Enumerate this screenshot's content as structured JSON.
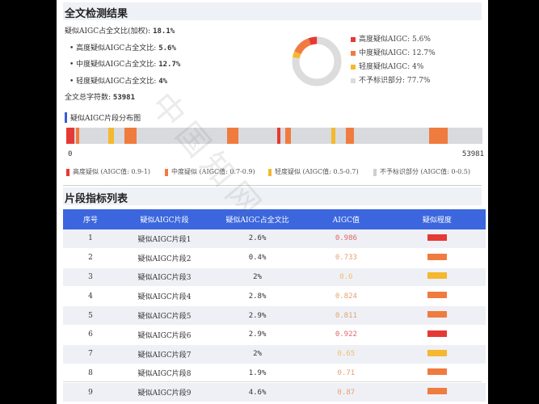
{
  "summary": {
    "title": "全文检测结果",
    "overall_label": "疑似AIGC占全文比(加权):",
    "overall_value": "18.1%",
    "high_label": "• 高度疑似AIGC占全文比:",
    "high_value": "5.6%",
    "mid_label": "• 中度疑似AIGC占全文比:",
    "mid_value": "12.7%",
    "low_label": "• 轻度疑似AIGC占全文比:",
    "low_value": "4%",
    "total_label": "全文总字符数:",
    "total_value": "53981"
  },
  "donut": {
    "legend": [
      {
        "label": "高度疑似AIGC: 5.6%",
        "color": "#e53935",
        "value": 5.6
      },
      {
        "label": "中度疑似AIGC: 12.7%",
        "color": "#f07b3f",
        "value": 12.7
      },
      {
        "label": "轻度疑似AIGC: 4%",
        "color": "#f5b82e",
        "value": 4
      },
      {
        "label": "不予标识部分: 77.7%",
        "color": "#dcdcdc",
        "value": 77.7
      }
    ]
  },
  "distribution": {
    "title": "疑似AIGC片段分布图",
    "start": "0",
    "end": "53981",
    "total": 53981,
    "segments": [
      {
        "start": 0,
        "end": 1100,
        "color": "#e53935"
      },
      {
        "start": 1250,
        "end": 1650,
        "color": "#f07b3f"
      },
      {
        "start": 5400,
        "end": 6200,
        "color": "#f5b82e"
      },
      {
        "start": 7550,
        "end": 9100,
        "color": "#f07b3f"
      },
      {
        "start": 20900,
        "end": 22300,
        "color": "#f07b3f"
      },
      {
        "start": 27400,
        "end": 27800,
        "color": "#e53935"
      },
      {
        "start": 28400,
        "end": 29100,
        "color": "#f07b3f"
      },
      {
        "start": 34400,
        "end": 34900,
        "color": "#f5b82e"
      },
      {
        "start": 36300,
        "end": 37300,
        "color": "#f07b3f"
      },
      {
        "start": 47100,
        "end": 49500,
        "color": "#f07b3f"
      }
    ],
    "legend": [
      {
        "label": "高度疑似 (AIGC值: 0.9-1)",
        "color": "#e53935"
      },
      {
        "label": "中度疑似 (AIGC值: 0.7-0.9)",
        "color": "#f07b3f"
      },
      {
        "label": "轻度疑似 (AIGC值: 0.5-0.7)",
        "color": "#f5b82e"
      },
      {
        "label": "不予标识部分 (AIGC值: 0-0.5)",
        "color": "#cfcfcf"
      }
    ]
  },
  "table": {
    "title": "片段指标列表",
    "headers": [
      "序号",
      "疑似AIGC片段",
      "疑似AIGC占全文比",
      "AIGC值",
      "疑似程度"
    ],
    "rows": [
      {
        "no": "1",
        "name": "疑似AIGC片段1",
        "ratio": "2.6%",
        "value": "0.986",
        "value_color": "#e06666",
        "sev_color": "#e53935"
      },
      {
        "no": "2",
        "name": "疑似AIGC片段2",
        "ratio": "0.4%",
        "value": "0.733",
        "value_color": "#e8a070",
        "sev_color": "#f07b3f"
      },
      {
        "no": "3",
        "name": "疑似AIGC片段3",
        "ratio": "2%",
        "value": "0.6",
        "value_color": "#f0c060",
        "sev_color": "#f5b82e"
      },
      {
        "no": "4",
        "name": "疑似AIGC片段4",
        "ratio": "2.8%",
        "value": "0.824",
        "value_color": "#e8a070",
        "sev_color": "#f07b3f"
      },
      {
        "no": "5",
        "name": "疑似AIGC片段5",
        "ratio": "2.9%",
        "value": "0.811",
        "value_color": "#e8a070",
        "sev_color": "#f07b3f"
      },
      {
        "no": "6",
        "name": "疑似AIGC片段6",
        "ratio": "2.9%",
        "value": "0.922",
        "value_color": "#e06666",
        "sev_color": "#e53935"
      },
      {
        "no": "7",
        "name": "疑似AIGC片段7",
        "ratio": "2%",
        "value": "0.65",
        "value_color": "#f0c060",
        "sev_color": "#f5b82e"
      },
      {
        "no": "8",
        "name": "疑似AIGC片段8",
        "ratio": "1.9%",
        "value": "0.71",
        "value_color": "#e8a070",
        "sev_color": "#f07b3f"
      },
      {
        "no": "9",
        "name": "疑似AIGC片段9",
        "ratio": "4.6%",
        "value": "0.87",
        "value_color": "#e8a070",
        "sev_color": "#f07b3f"
      }
    ]
  },
  "watermark": "中国知网"
}
